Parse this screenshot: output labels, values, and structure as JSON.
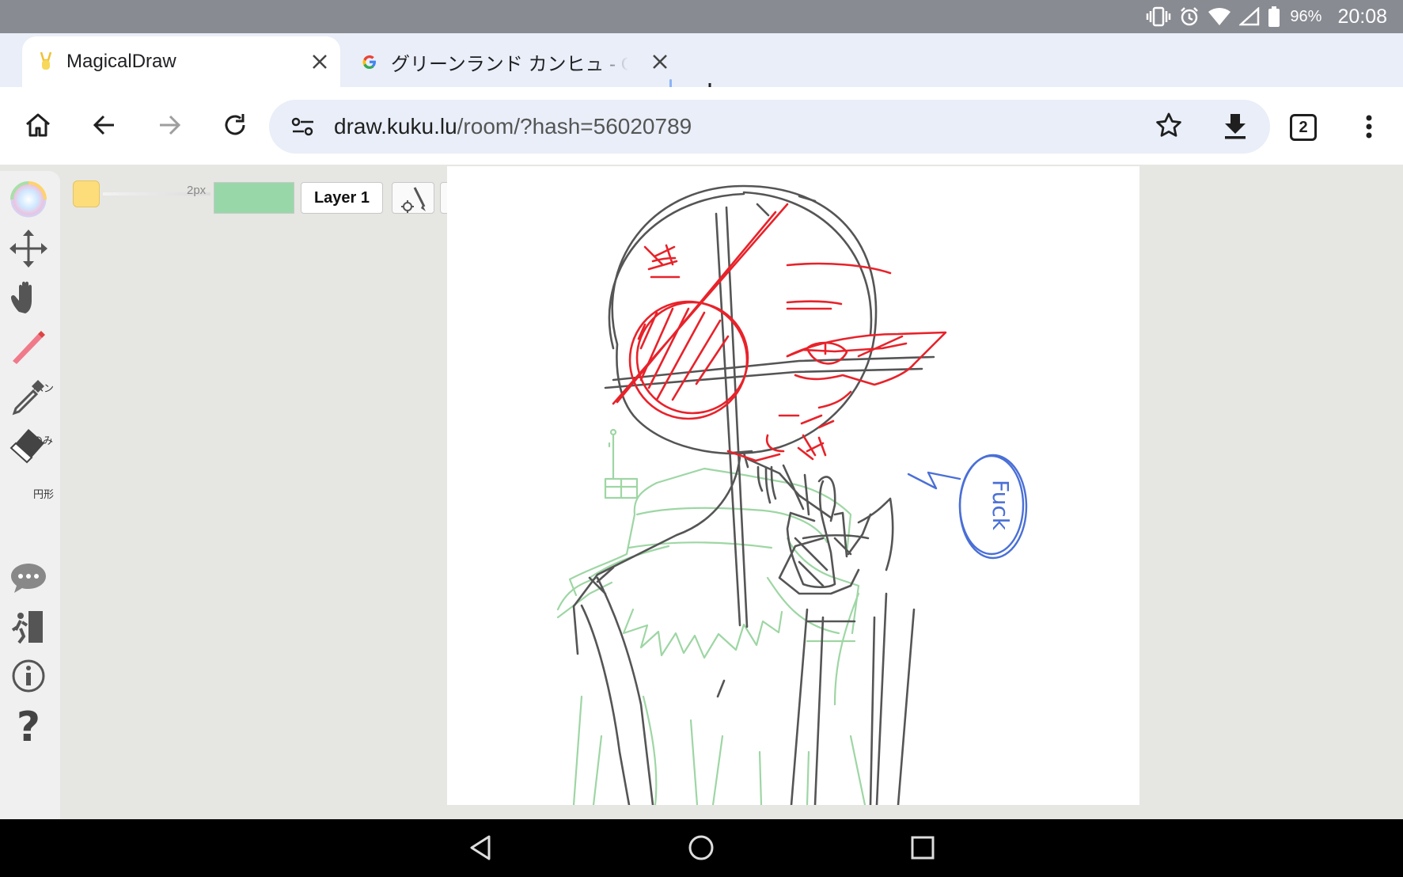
{
  "status_bar": {
    "battery": "96%",
    "time": "20:08",
    "icons": [
      "vibrate-icon",
      "alarm-icon",
      "wifi-icon",
      "cell-signal-icon",
      "battery-icon"
    ]
  },
  "tabs": [
    {
      "title": "MagicalDraw",
      "favicon": "magicaldraw-favicon",
      "active": true
    },
    {
      "title": "グリーンランド カンヒュ - G",
      "favicon": "google-favicon",
      "active": false
    }
  ],
  "toolbar": {
    "url_host": "draw.kuku.lu",
    "url_path": "/room/?hash=56020789",
    "tab_count": "2"
  },
  "drawing_app": {
    "tools": [
      {
        "name": "color-wheel",
        "label": ""
      },
      {
        "name": "move",
        "label": ""
      },
      {
        "name": "hand",
        "label": ""
      },
      {
        "name": "pen",
        "label": "ペン"
      },
      {
        "name": "eyedropper",
        "label": "色のみ"
      },
      {
        "name": "eraser",
        "label": "円形"
      },
      {
        "name": "chat",
        "label": ""
      },
      {
        "name": "exit",
        "label": ""
      },
      {
        "name": "info",
        "label": ""
      },
      {
        "name": "help",
        "label": ""
      }
    ],
    "brush_size": "2px",
    "brush_color": "#fddd7a",
    "layer_label": "Layer 1",
    "canvas_text": "Fuck"
  },
  "colors": {
    "status_bar": "#898b93",
    "tab_strip": "#e9eef8",
    "canvas_bg": "#ffffff",
    "ink_gray": "#555555",
    "ink_red": "#e8222a",
    "ink_green": "#9ed6a4",
    "ink_blue": "#4a6fd6"
  }
}
